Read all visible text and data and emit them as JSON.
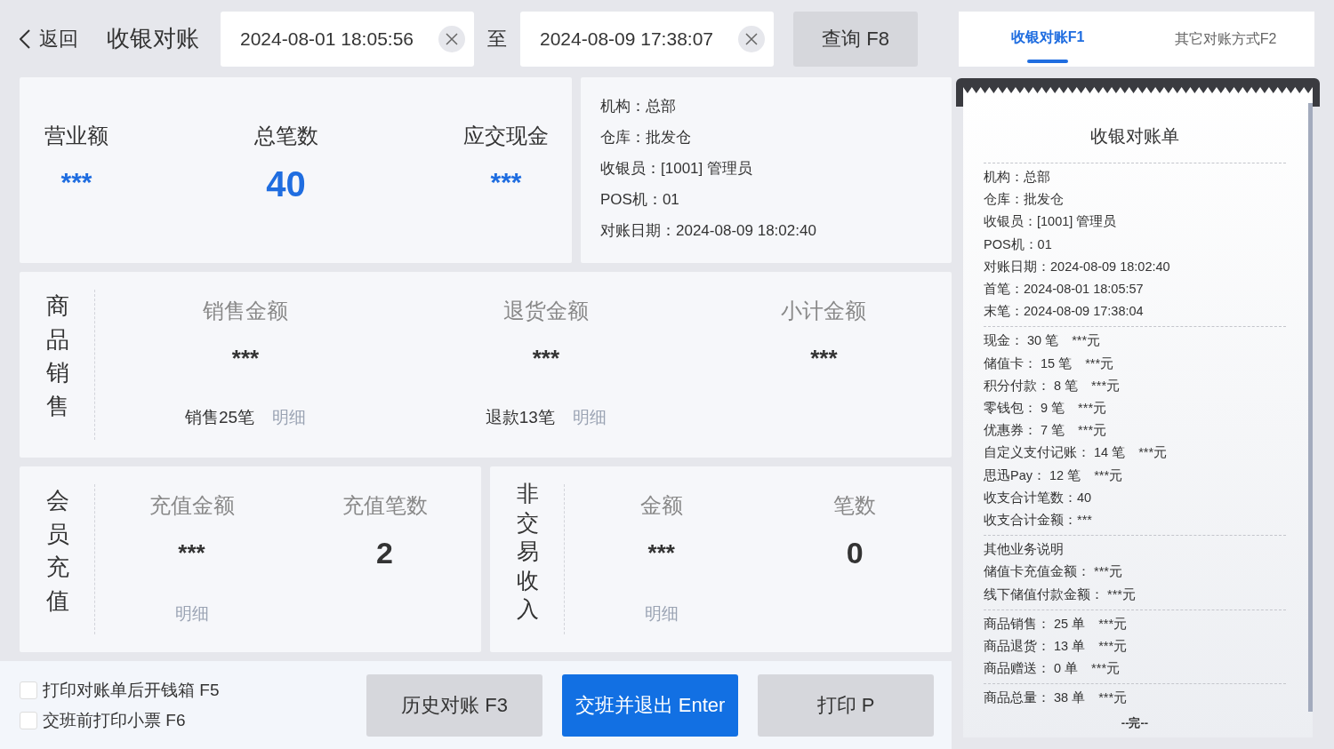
{
  "header": {
    "back": "返回",
    "title": "收银对账",
    "start": "2024-08-01 18:05:56",
    "separator": "至",
    "end": "2024-08-09 17:38:07",
    "query": "查询 F8"
  },
  "tabs": [
    {
      "label": "收银对账F1",
      "selected": true
    },
    {
      "label": "其它对账方式F2",
      "selected": false
    }
  ],
  "summary": [
    {
      "label": "营业额",
      "value": "***",
      "kind": "masked"
    },
    {
      "label": "总笔数",
      "value": "40",
      "kind": "count"
    },
    {
      "label": "应交现金",
      "value": "***",
      "kind": "masked"
    }
  ],
  "info": [
    "机构：总部",
    "仓库：批发仓",
    "收银员：[1001] 管理员",
    "POS机：01",
    "对账日期：2024-08-09 18:02:40"
  ],
  "sales": {
    "title": "商品销售",
    "columns": [
      {
        "label": "销售金额",
        "value": "***",
        "note": "销售25笔",
        "link": "明细"
      },
      {
        "label": "退货金额",
        "value": "***",
        "note": "退款13笔",
        "link": "明细"
      },
      {
        "label": "小计金额",
        "value": "***"
      }
    ]
  },
  "groups": [
    {
      "title": "会员充值",
      "columns": [
        {
          "label": "充值金额",
          "value": "***",
          "kind": "masked",
          "link": "明细"
        },
        {
          "label": "充值笔数",
          "value": "2",
          "kind": "count"
        }
      ]
    },
    {
      "title": "非交易收入",
      "columns": [
        {
          "label": "金额",
          "value": "***",
          "kind": "masked",
          "link": "明细"
        },
        {
          "label": "笔数",
          "value": "0",
          "kind": "count"
        }
      ]
    }
  ],
  "options": [
    {
      "label": "打印对账单后开钱箱 F5",
      "checked": false
    },
    {
      "label": "交班前打印小票 F6",
      "checked": false
    }
  ],
  "buttons": [
    {
      "label": "历史对账 F3",
      "kind": "secondary"
    },
    {
      "label": "交班并退出 Enter",
      "kind": "primary"
    },
    {
      "label": "打印 P",
      "kind": "secondary"
    }
  ],
  "receipt": {
    "title": "收银对账单",
    "sections": [
      [
        "机构：总部",
        "仓库：批发仓",
        "收银员：[1001] 管理员",
        "POS机：01",
        "对账日期：2024-08-09 18:02:40",
        "首笔：2024-08-01 18:05:57",
        "末笔：2024-08-09 17:38:04"
      ],
      [
        "现金： 30 笔　***元",
        "储值卡： 15 笔　***元",
        "积分付款： 8 笔　***元",
        "零钱包： 9 笔　***元",
        "优惠券： 7 笔　***元",
        "自定义支付记账： 14 笔　***元",
        "思迅Pay： 12 笔　***元",
        "收支合计笔数：40",
        "收支合计金额：***"
      ],
      [
        "其他业务说明",
        "储值卡充值金额： ***元",
        "线下储值付款金额： ***元"
      ],
      [
        "商品销售： 25 单　***元",
        "商品退货： 13 单　***元",
        "商品赠送： 0 单　***元"
      ],
      [
        "商品总量： 38 单　***元"
      ]
    ],
    "end": "--完--"
  }
}
